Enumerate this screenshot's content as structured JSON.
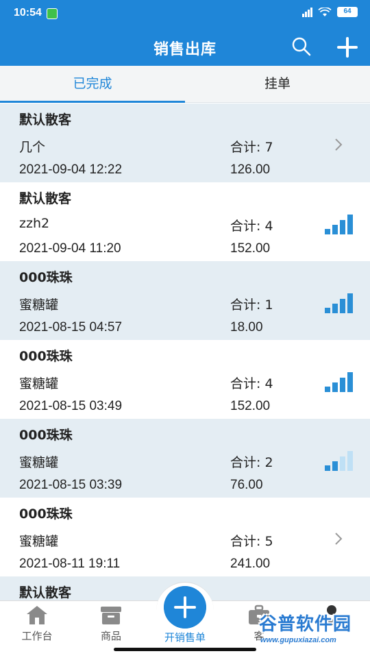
{
  "status_bar": {
    "time": "10:54",
    "battery": "64",
    "icons": [
      "app-notification-icon",
      "hd-signal-icon",
      "wifi-icon",
      "battery-icon"
    ]
  },
  "header": {
    "title": "销售出库",
    "icons": [
      "search-icon",
      "add-icon"
    ]
  },
  "tabs": [
    {
      "label": "已完成",
      "active": true
    },
    {
      "label": "挂单",
      "active": false
    }
  ],
  "orders": [
    {
      "customer": "默认散客",
      "item": "几个",
      "total": "合计: 7",
      "date": "2021-09-04 12:22",
      "amount": "126.00",
      "indicator": "chevron",
      "shaded": true
    },
    {
      "customer": "默认散客",
      "item": "zzh2",
      "total": "合计: 4",
      "date": "2021-09-04 11:20",
      "amount": "152.00",
      "indicator": "bars",
      "level": 4,
      "shaded": false
    },
    {
      "customer": "000珠珠",
      "item": "蜜糖罐",
      "total": "合计: 1",
      "date": "2021-08-15 04:57",
      "amount": "18.00",
      "indicator": "bars",
      "level": 4,
      "shaded": true
    },
    {
      "customer": "000珠珠",
      "item": "蜜糖罐",
      "total": "合计: 4",
      "date": "2021-08-15 03:49",
      "amount": "152.00",
      "indicator": "bars",
      "level": 4,
      "shaded": false
    },
    {
      "customer": "000珠珠",
      "item": "蜜糖罐",
      "total": "合计: 2",
      "date": "2021-08-15 03:39",
      "amount": "76.00",
      "indicator": "bars",
      "level": 2,
      "shaded": true
    },
    {
      "customer": "000珠珠",
      "item": "蜜糖罐",
      "total": "合计: 5",
      "date": "2021-08-11 19:11",
      "amount": "241.00",
      "indicator": "chevron",
      "shaded": false
    },
    {
      "customer": "默认散客",
      "item": "",
      "total": "",
      "date": "",
      "amount": "",
      "indicator": "none",
      "shaded": true
    }
  ],
  "bottom_nav": [
    {
      "label": "工作台",
      "icon": "home-icon"
    },
    {
      "label": "商品",
      "icon": "box-icon"
    },
    {
      "label": "开销售单",
      "icon": "plus-icon"
    },
    {
      "label": "客",
      "icon": "briefcase-icon"
    },
    {
      "label": "",
      "icon": "user-settings-icon"
    }
  ],
  "colors": {
    "primary": "#1f86d8",
    "row_shade": "#e4edf3",
    "bar_active": "#2a8fd6",
    "bar_inactive": "#bfe0f5"
  },
  "watermark": {
    "logo_text": "谷普软件园",
    "url": "www.gupuxiazai.com"
  }
}
